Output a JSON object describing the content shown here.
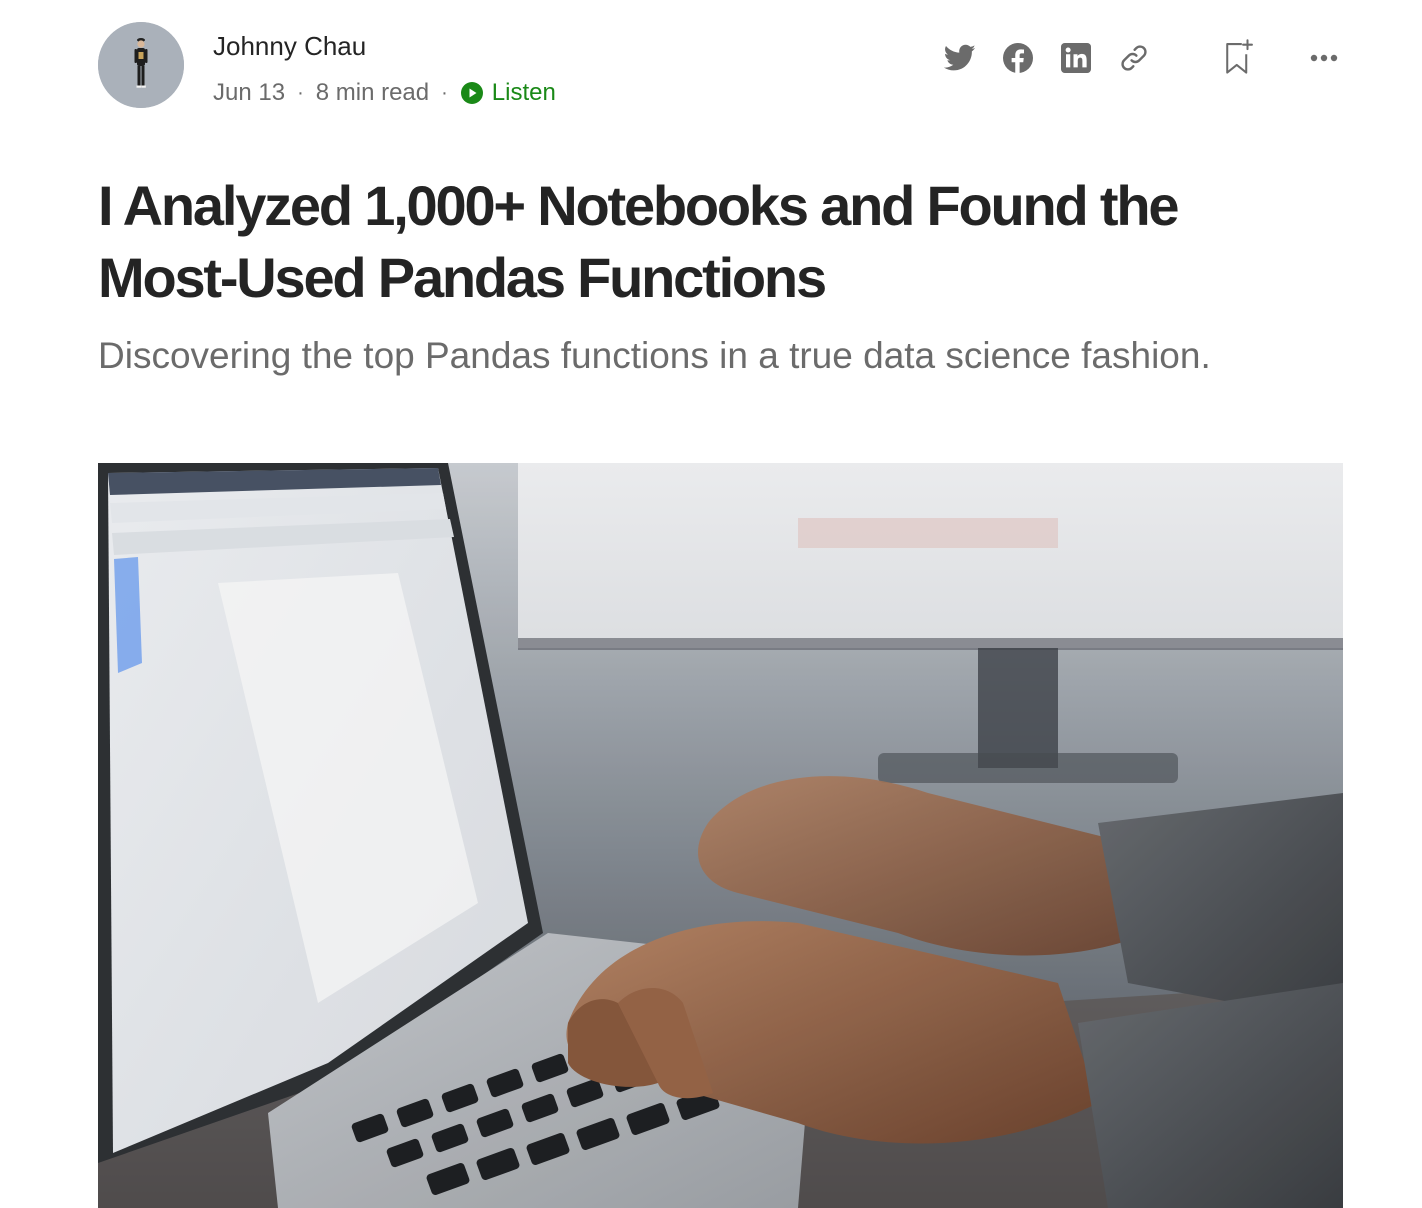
{
  "author": {
    "name": "Johnny Chau",
    "avatar_icon": "avatar-person-icon"
  },
  "meta": {
    "date": "Jun 13",
    "read_time": "8 min read",
    "listen_label": "Listen",
    "listen_icon": "play-circle-icon",
    "listen_color": "#1a8917"
  },
  "actions": {
    "share": [
      {
        "icon": "twitter-icon"
      },
      {
        "icon": "facebook-icon"
      },
      {
        "icon": "linkedin-icon"
      },
      {
        "icon": "copy-link-icon"
      }
    ],
    "save_icon": "bookmark-add-icon",
    "more_icon": "more-options-icon"
  },
  "article": {
    "title": "I Analyzed 1,000+ Notebooks and Found the Most-Used Pandas Functions",
    "subtitle": "Discovering the top Pandas functions in a true data science fashion."
  },
  "colors": {
    "text_primary": "#242424",
    "text_secondary": "#6b6b6b",
    "icon": "#6b6b6b",
    "accent": "#1a8917"
  }
}
